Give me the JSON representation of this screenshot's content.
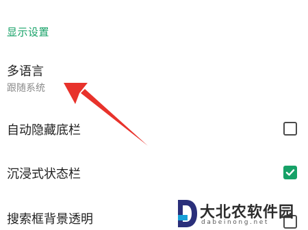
{
  "section": {
    "title": "显示设置"
  },
  "settings": [
    {
      "title": "多语言",
      "subtitle": "跟随系统"
    },
    {
      "title": "自动隐藏底栏",
      "checked": false
    },
    {
      "title": "沉浸式状态栏",
      "checked": true
    },
    {
      "title": "搜索框背景透明",
      "checked": false
    }
  ],
  "watermark": {
    "title": "大北农软件园",
    "url": "dabeinong.net"
  },
  "colors": {
    "accent": "#16a167",
    "annotation_arrow": "#e8322b"
  }
}
